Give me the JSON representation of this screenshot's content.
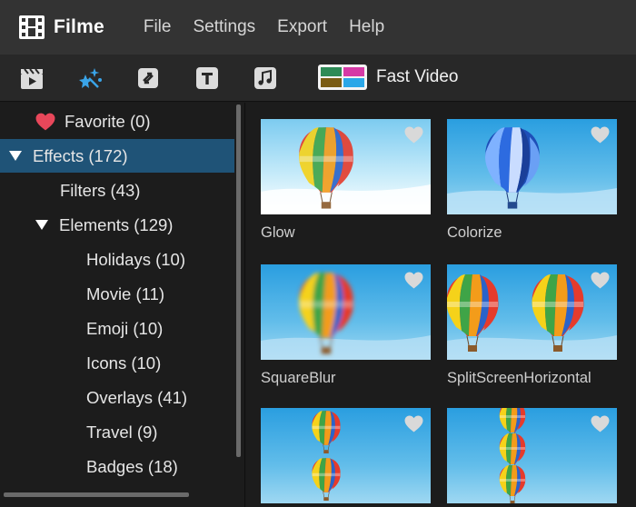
{
  "app": {
    "title": "Filme"
  },
  "menu": [
    "File",
    "Settings",
    "Export",
    "Help"
  ],
  "toolbar": {
    "tools": [
      {
        "icon": "media-clapper-icon"
      },
      {
        "icon": "effects-sparkle-icon",
        "active": true
      },
      {
        "icon": "transition-icon"
      },
      {
        "icon": "text-icon"
      },
      {
        "icon": "music-icon"
      }
    ],
    "fast_video_label": "Fast Video"
  },
  "sidebar": {
    "items": [
      {
        "label": "Favorite (0)",
        "level": 0,
        "icon": "heart-icon"
      },
      {
        "label": "Effects (172)",
        "level": 0,
        "expanded": true,
        "selected": true
      },
      {
        "label": "Filters (43)",
        "level": 1
      },
      {
        "label": "Elements (129)",
        "level": 1,
        "expanded": true
      },
      {
        "label": "Holidays (10)",
        "level": 2
      },
      {
        "label": "Movie (11)",
        "level": 2
      },
      {
        "label": "Emoji (10)",
        "level": 2
      },
      {
        "label": "Icons (10)",
        "level": 2
      },
      {
        "label": "Overlays (41)",
        "level": 2
      },
      {
        "label": "Travel (9)",
        "level": 2
      },
      {
        "label": "Badges (18)",
        "level": 2
      }
    ]
  },
  "effects": [
    {
      "label": "Glow"
    },
    {
      "label": "Colorize"
    },
    {
      "label": "SquareBlur"
    },
    {
      "label": "SplitScreenHorizontal"
    },
    {
      "label": ""
    },
    {
      "label": ""
    }
  ],
  "colors": {
    "menubar": "#333333",
    "toolbar": "#282828",
    "background": "#1c1c1c",
    "selection": "#1f5377",
    "heart": "#e8475a",
    "sky": "#3ea7e0"
  }
}
